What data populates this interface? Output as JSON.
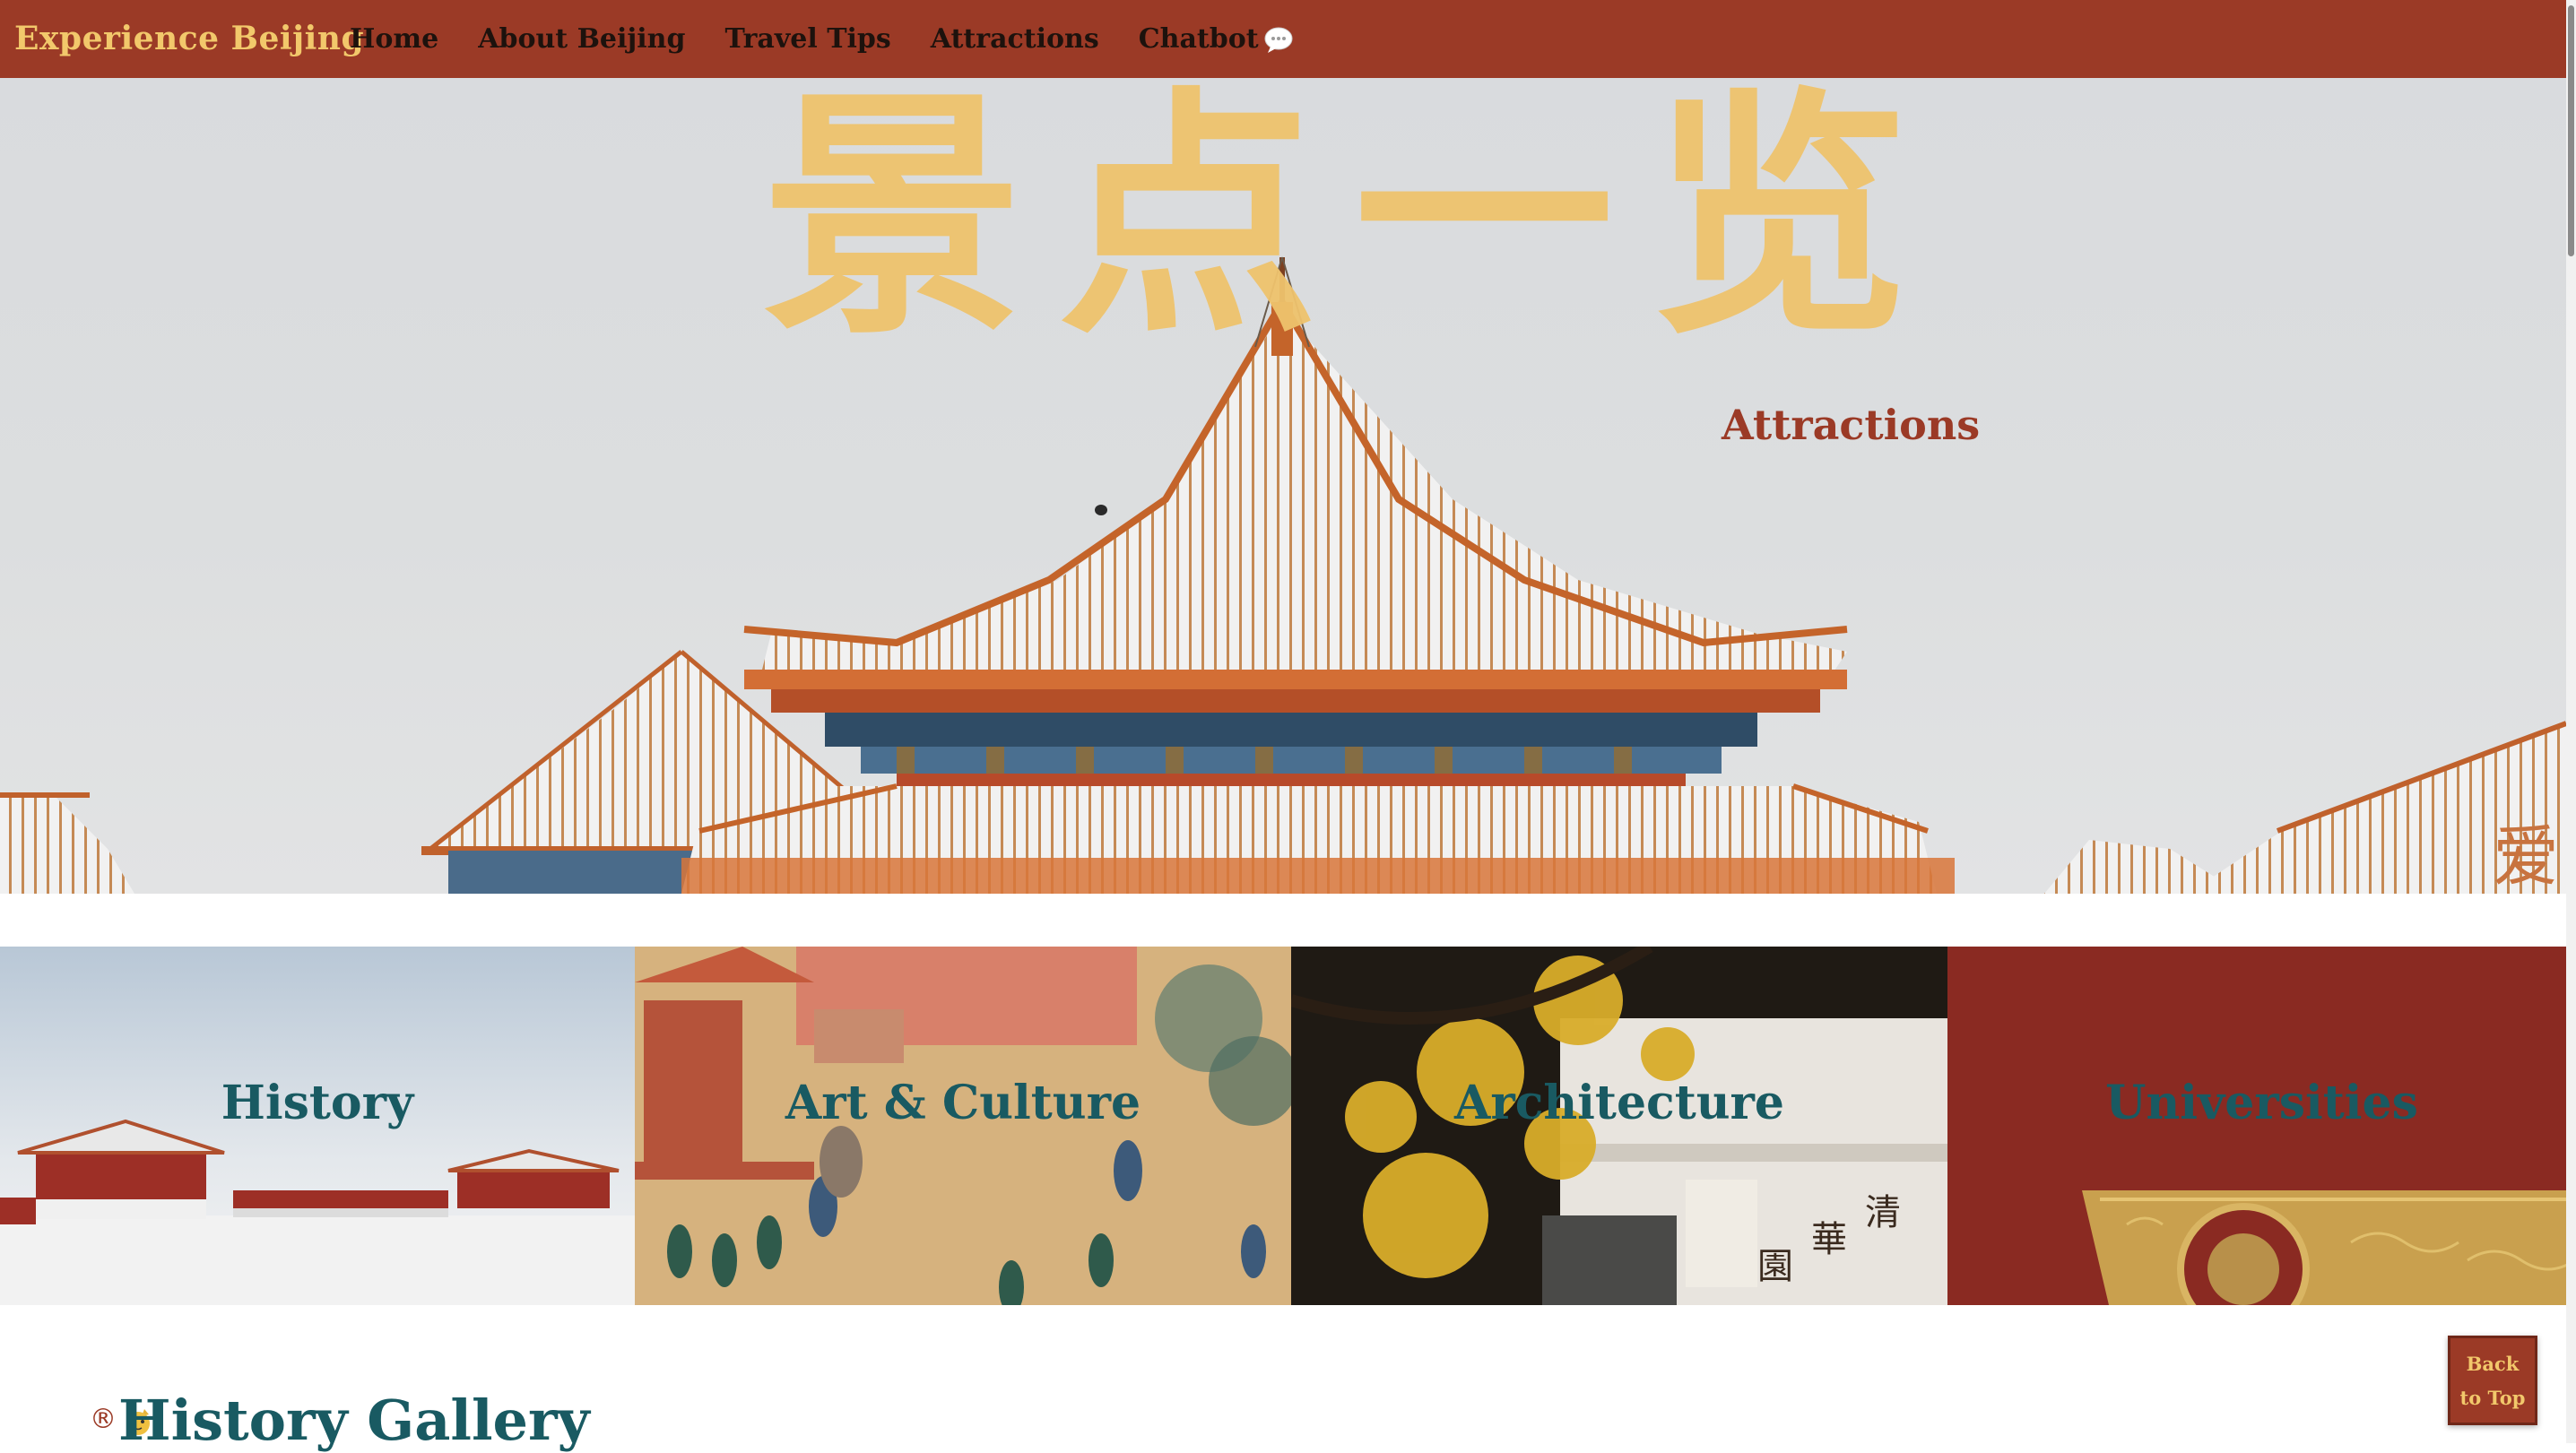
{
  "navbar": {
    "brand": "Experience Beijing",
    "links": [
      {
        "label": "Home"
      },
      {
        "label": "About Beijing"
      },
      {
        "label": "Travel Tips"
      },
      {
        "label": "Attractions"
      },
      {
        "label": "Chatbot"
      }
    ],
    "chat_icon": "speech-bubble-icon"
  },
  "hero": {
    "title_cn": "景点一览",
    "subtitle": "Attractions",
    "corner_char": "爱"
  },
  "categories": [
    {
      "label": "History"
    },
    {
      "label": "Art & Culture"
    },
    {
      "label": "Architecture"
    },
    {
      "label": "Universities"
    }
  ],
  "gallery": {
    "mark": "®",
    "heading": "History Gallery"
  },
  "back_to_top": {
    "line1": "Back",
    "line2": "to Top"
  },
  "colors": {
    "nav_bg": "#9b3a26",
    "brand": "#f2c86b",
    "teal_heading": "#195a62",
    "hero_title": "#efc36d"
  }
}
